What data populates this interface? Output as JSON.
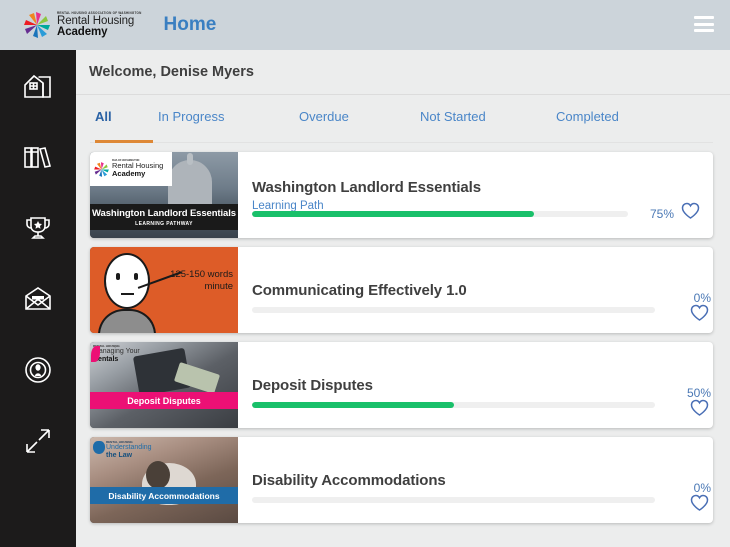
{
  "header": {
    "brand": {
      "association_line": "RENTAL HOUSING ASSOCIATION OF WASHINGTON",
      "line1": "Rental Housing",
      "line2": "Academy",
      "logo_icon": "pinwheel-star-logo"
    },
    "page_title": "Home",
    "menu_icon": "hamburger-menu-icon"
  },
  "sidebar": {
    "items": [
      {
        "icon": "home-house-icon",
        "name": "home"
      },
      {
        "icon": "books-library-icon",
        "name": "library"
      },
      {
        "icon": "trophy-award-icon",
        "name": "achievements"
      },
      {
        "icon": "envelope-mail-icon",
        "name": "messages"
      },
      {
        "icon": "podcast-broadcast-icon",
        "name": "broadcasts"
      },
      {
        "icon": "expand-arrows-icon",
        "name": "expand"
      }
    ]
  },
  "main": {
    "welcome": "Welcome, Denise Myers",
    "tabs": [
      {
        "label": "All",
        "active": true
      },
      {
        "label": "In Progress",
        "active": false
      },
      {
        "label": "Overdue",
        "active": false
      },
      {
        "label": "Not Started",
        "active": false
      },
      {
        "label": "Completed",
        "active": false
      }
    ],
    "cards": [
      {
        "title": "Washington Landlord Essentials",
        "subtitle": "Learning Path",
        "progress": 75,
        "progress_label": "75%",
        "favorite_icon": "heart-outline-icon",
        "thumbnail": {
          "banner_title": "Washington Landlord Essentials",
          "banner_subtitle": "LEARNING PATHWAY",
          "banner_color": "#1a1a1a",
          "image_desc": "capitol-dome-photo"
        }
      },
      {
        "title": "Communicating Effectively 1.0",
        "subtitle": "",
        "progress": 0,
        "progress_label": "0%",
        "favorite_icon": "heart-outline-icon",
        "thumbnail": {
          "banner_title": "",
          "banner_subtitle": "",
          "banner_color": "#dd5c28",
          "caption": "125-150 words minute",
          "image_desc": "cartoon-speaker-illustration"
        }
      },
      {
        "title": "Deposit Disputes",
        "subtitle": "",
        "progress": 50,
        "progress_label": "50%",
        "favorite_icon": "heart-outline-icon",
        "thumbnail": {
          "banner_title": "Deposit Disputes",
          "banner_subtitle": "",
          "banner_color": "#ec1075",
          "series_line1": "Managing Your",
          "series_line2": "Rentals",
          "image_desc": "wallet-with-money-photo"
        }
      },
      {
        "title": "Disability Accommodations",
        "subtitle": "",
        "progress": 0,
        "progress_label": "0%",
        "favorite_icon": "heart-outline-icon",
        "thumbnail": {
          "banner_title": "Disability Accommodations",
          "banner_subtitle": "",
          "banner_color": "#1f6ca8",
          "series_line1": "Understanding",
          "series_line2": "the Law",
          "image_desc": "dog-photo"
        }
      }
    ]
  },
  "colors": {
    "header_bg": "#ccd4da",
    "sidebar_bg": "#1c1b1b",
    "page_bg": "#eceded",
    "accent_blue": "#3a7fc1",
    "tab_active_underline": "#de8836",
    "progress_green": "#19c06a"
  }
}
